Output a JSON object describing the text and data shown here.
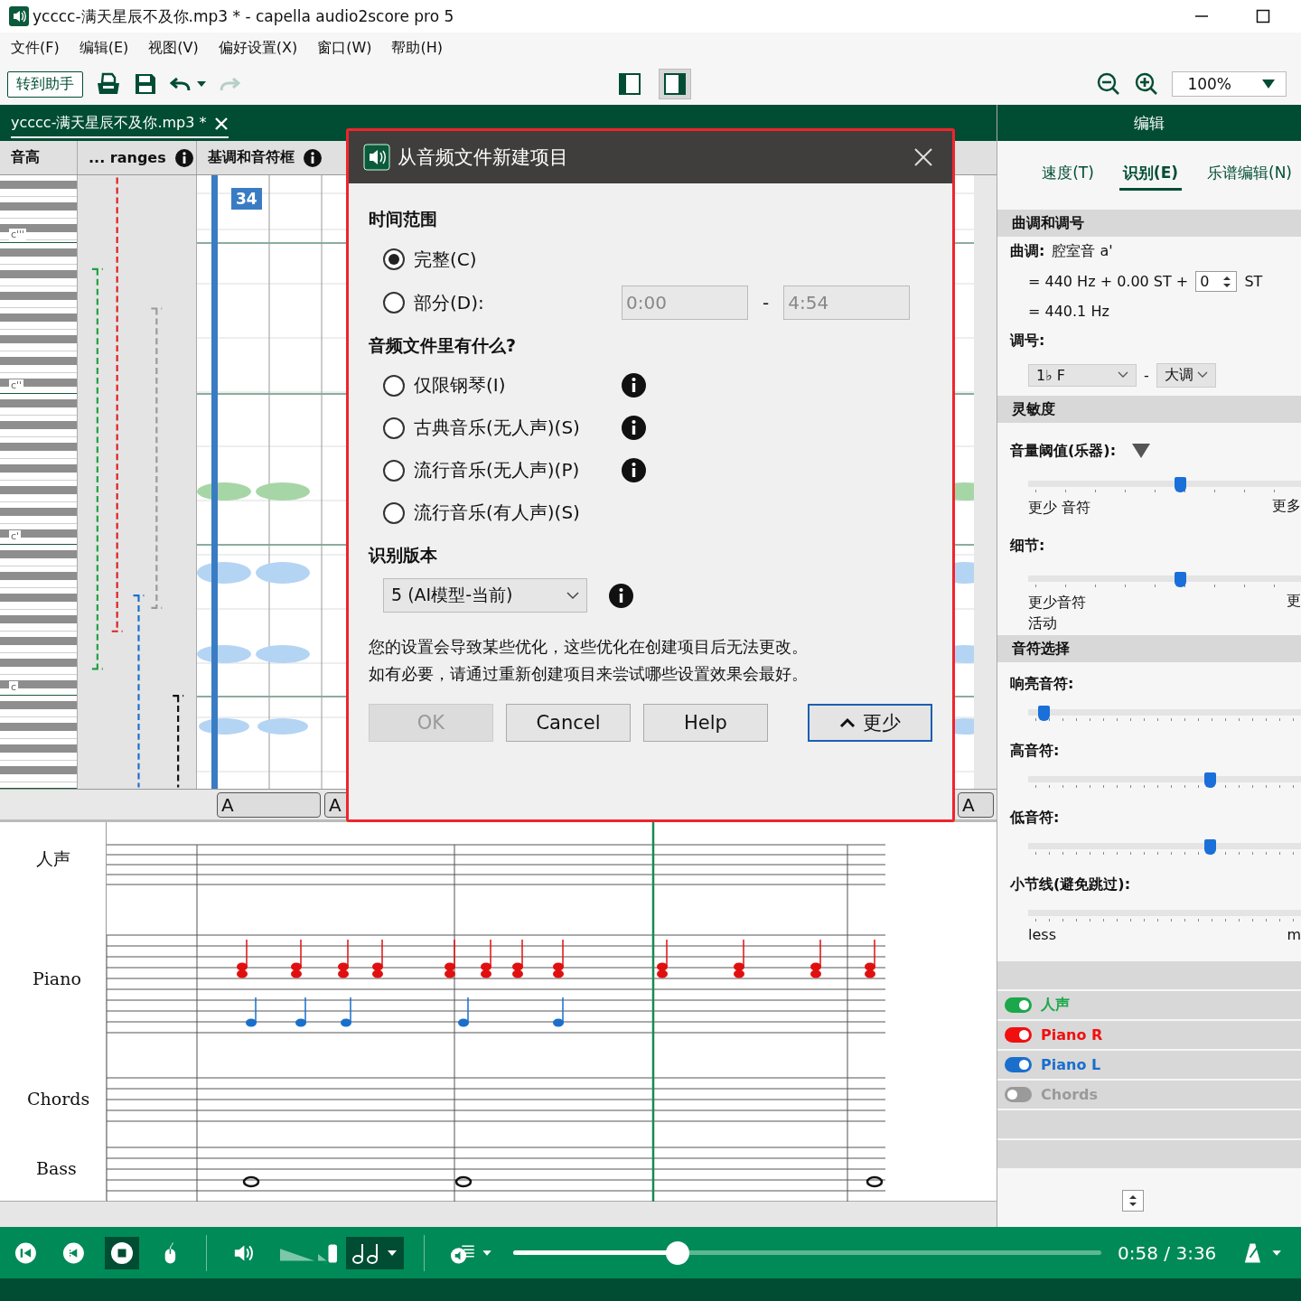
{
  "window": {
    "title": "ycccc-满天星辰不及你.mp3 * - capella audio2score pro 5"
  },
  "menu": [
    "文件(F)",
    "编辑(E)",
    "视图(V)",
    "偏好设置(X)",
    "窗口(W)",
    "帮助(H)"
  ],
  "toolbar": {
    "assistant_button": "转到助手",
    "layout_buttons": [
      {
        "kind": "left",
        "selected": false
      },
      {
        "kind": "right",
        "selected": true
      }
    ],
    "zoom": "100%"
  },
  "document_tab": {
    "label": "ycccc-满天星辰不及你.mp3 *"
  },
  "columns": [
    "音高",
    "... ranges",
    "基调和音符框"
  ],
  "octave_labels": [
    "c'''",
    "c''",
    "c'",
    "c"
  ],
  "measure_number": "34",
  "sections": [
    "A",
    "A",
    "A"
  ],
  "staves": [
    {
      "name": "人声"
    },
    {
      "name": "Piano"
    },
    {
      "name": "Chords"
    },
    {
      "name": "Bass"
    }
  ],
  "player": {
    "time": "0:58 / 3:36",
    "level": 0.28
  },
  "panel": {
    "title": "编辑",
    "tabs": [
      {
        "label": "速度(T)",
        "selected": false
      },
      {
        "label": "识别(E)",
        "selected": true
      },
      {
        "label": "乐谱编辑(N)",
        "selected": false
      }
    ],
    "key": {
      "heading": "曲调和调号",
      "tuning_label": "曲调:",
      "tuning_value": "腔室音 a'",
      "formula": "= 440 Hz + 0.00 ST  +",
      "spin_value": "0",
      "unit": "ST",
      "result": "= 440.1 Hz",
      "signature_label": "调号:",
      "signature": "1♭ F",
      "dash": "-",
      "mode": "大调"
    },
    "sensitivity": {
      "heading": "灵敏度",
      "sliders": [
        {
          "label": "音量阈值(乐器):",
          "menu": true,
          "level": 0.56,
          "low": [
            "更少 音符"
          ],
          "high": "更多"
        },
        {
          "label": "细节:",
          "menu": false,
          "level": 0.56,
          "low": [
            "更少音符",
            "活动"
          ],
          "high": "更"
        }
      ]
    },
    "note_selection": {
      "heading": "音符选择",
      "sliders": [
        {
          "label": "响亮音符:",
          "level": 0.06
        },
        {
          "label": "高音符:",
          "level": 0.67
        },
        {
          "label": "低音符:",
          "level": 0.67
        },
        {
          "label": "小节线(避免跳过):",
          "low": "less",
          "high": "m"
        }
      ]
    },
    "voices": [
      {
        "name": "人声",
        "on": true,
        "color": "#1aa84a"
      },
      {
        "name": "Piano R",
        "on": true,
        "color": "#f01010"
      },
      {
        "name": "Piano L",
        "on": true,
        "color": "#1a6fcc"
      },
      {
        "name": "Chords",
        "on": false,
        "color": "#9a9a9a"
      }
    ]
  },
  "dialog": {
    "title": "从音频文件新建项目",
    "time_range": {
      "heading": "时间范围",
      "options": [
        {
          "label": "完整(C)",
          "selected": true
        },
        {
          "label": "部分(D):",
          "selected": false
        }
      ],
      "from": "0:00",
      "separator": "-",
      "to": "4:54"
    },
    "content": {
      "heading": "音频文件里有什么?",
      "options": [
        {
          "label": "仅限钢琴(I)",
          "selected": false,
          "info": true
        },
        {
          "label": "古典音乐(无人声)(S)",
          "selected": false,
          "info": true
        },
        {
          "label": "流行音乐(无人声)(P)",
          "selected": false,
          "info": true
        },
        {
          "label": "流行音乐(有人声)(S)",
          "selected": false,
          "info": false
        }
      ]
    },
    "version": {
      "heading": "识别版本",
      "value": "5 (AI模型-当前)"
    },
    "note": [
      "您的设置会导致某些优化，这些优化在创建项目后无法更改。",
      "如有必要，请通过重新创建项目来尝试哪些设置效果会最好。"
    ],
    "buttons": [
      {
        "label": "OK",
        "disabled": true,
        "default": false
      },
      {
        "label": "Cancel",
        "disabled": false,
        "default": false
      },
      {
        "label": "Help",
        "disabled": false,
        "default": false
      },
      {
        "label": "更少",
        "disabled": false,
        "default": true
      }
    ]
  }
}
